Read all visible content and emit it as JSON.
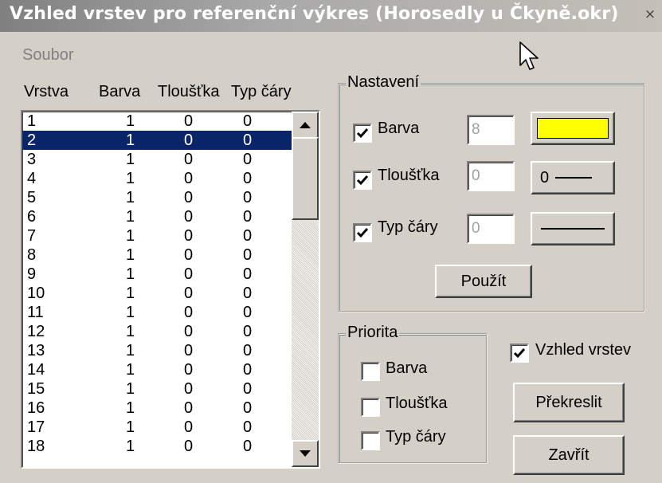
{
  "window": {
    "title": "Vzhled vrstev pro referenční výkres (Horosedly u Čkyně.okr)",
    "close_glyph": "×"
  },
  "menu": {
    "file_label": "Soubor"
  },
  "list": {
    "headers": [
      "Vrstva",
      "Barva",
      "Tloušťka",
      "Typ čáry"
    ],
    "selected_index": 1,
    "rows": [
      [
        "1",
        "1",
        "0",
        "0"
      ],
      [
        "2",
        "1",
        "0",
        "0"
      ],
      [
        "3",
        "1",
        "0",
        "0"
      ],
      [
        "4",
        "1",
        "0",
        "0"
      ],
      [
        "5",
        "1",
        "0",
        "0"
      ],
      [
        "6",
        "1",
        "0",
        "0"
      ],
      [
        "7",
        "1",
        "0",
        "0"
      ],
      [
        "8",
        "1",
        "0",
        "0"
      ],
      [
        "9",
        "1",
        "0",
        "0"
      ],
      [
        "10",
        "1",
        "0",
        "0"
      ],
      [
        "11",
        "1",
        "0",
        "0"
      ],
      [
        "12",
        "1",
        "0",
        "0"
      ],
      [
        "13",
        "1",
        "0",
        "0"
      ],
      [
        "14",
        "1",
        "0",
        "0"
      ],
      [
        "15",
        "1",
        "0",
        "0"
      ],
      [
        "16",
        "1",
        "0",
        "0"
      ],
      [
        "17",
        "1",
        "0",
        "0"
      ],
      [
        "18",
        "1",
        "0",
        "0"
      ]
    ]
  },
  "settings": {
    "group_label": "Nastavení",
    "color": {
      "label": "Barva",
      "checked": true,
      "value": "8",
      "swatch": "#ffff00"
    },
    "thickness": {
      "label": "Tloušťka",
      "checked": true,
      "value": "0",
      "button_text": "0"
    },
    "linetype": {
      "label": "Typ čáry",
      "checked": true,
      "value": "0"
    },
    "apply_label": "Použít"
  },
  "priority": {
    "group_label": "Priorita",
    "items": [
      {
        "label": "Barva",
        "checked": false
      },
      {
        "label": "Tloušťka",
        "checked": false
      },
      {
        "label": "Typ čáry",
        "checked": false
      }
    ]
  },
  "appearance": {
    "label": "Vzhled vrstev",
    "checked": true
  },
  "buttons": {
    "redraw_label": "Překreslit",
    "close_label": "Zavřít"
  }
}
